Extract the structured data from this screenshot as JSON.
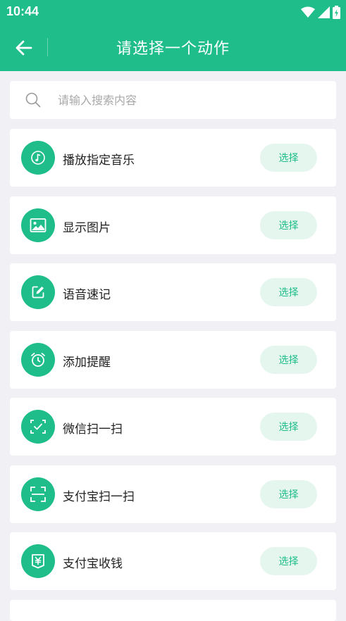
{
  "status_bar": {
    "time": "10:44"
  },
  "header": {
    "title": "请选择一个动作"
  },
  "search": {
    "placeholder": "请输入搜索内容",
    "value": ""
  },
  "actions": [
    {
      "label": "播放指定音乐",
      "icon": "music-note-icon",
      "button": "选择"
    },
    {
      "label": "显示图片",
      "icon": "image-icon",
      "button": "选择"
    },
    {
      "label": "语音速记",
      "icon": "edit-note-icon",
      "button": "选择"
    },
    {
      "label": "添加提醒",
      "icon": "alarm-clock-icon",
      "button": "选择"
    },
    {
      "label": "微信扫一扫",
      "icon": "scan-check-icon",
      "button": "选择"
    },
    {
      "label": "支付宝扫一扫",
      "icon": "scan-frame-icon",
      "button": "选择"
    },
    {
      "label": "支付宝收钱",
      "icon": "yen-wallet-icon",
      "button": "选择"
    }
  ],
  "colors": {
    "primary": "#1ebd8a",
    "button_bg": "#e5f6ef",
    "page_bg": "#f0f0f5"
  }
}
